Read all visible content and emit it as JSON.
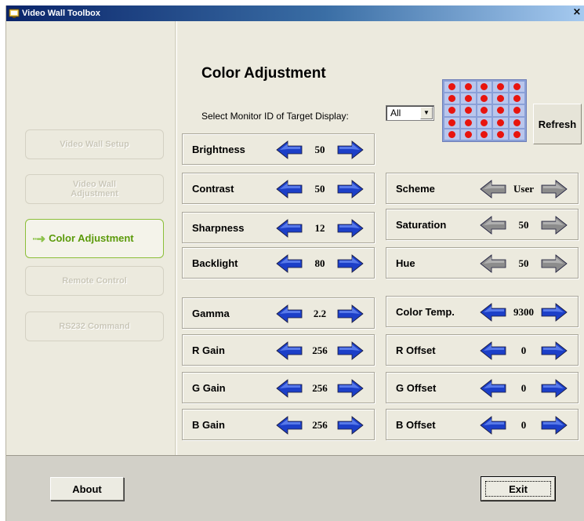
{
  "window": {
    "title": "Video Wall Toolbox",
    "close_glyph": "×"
  },
  "sidebar": {
    "items": [
      {
        "label": "Video Wall Setup",
        "state": "disabled"
      },
      {
        "label": "Video Wall Adjustment",
        "state": "disabled"
      },
      {
        "label": "Color Adjustment",
        "state": "active"
      },
      {
        "label": "Remote Control",
        "state": "disabled"
      },
      {
        "label": "RS232 Command",
        "state": "disabled"
      }
    ]
  },
  "main": {
    "heading": "Color Adjustment",
    "monitor_label": "Select Monitor ID of Target Display:",
    "monitor_value": "All",
    "refresh_label": "Refresh",
    "controls": [
      {
        "id": "brightness",
        "label": "Brightness",
        "value": "50",
        "enabled": true
      },
      {
        "id": "contrast",
        "label": "Contrast",
        "value": "50",
        "enabled": true
      },
      {
        "id": "scheme",
        "label": "Scheme",
        "value": "User",
        "enabled": false
      },
      {
        "id": "sharpness",
        "label": "Sharpness",
        "value": "12",
        "enabled": true
      },
      {
        "id": "saturation",
        "label": "Saturation",
        "value": "50",
        "enabled": false
      },
      {
        "id": "backlight",
        "label": "Backlight",
        "value": "80",
        "enabled": true
      },
      {
        "id": "hue",
        "label": "Hue",
        "value": "50",
        "enabled": false
      },
      {
        "id": "gamma",
        "label": "Gamma",
        "value": "2.2",
        "enabled": true
      },
      {
        "id": "color-temp",
        "label": "Color Temp.",
        "value": "9300",
        "enabled": true
      },
      {
        "id": "r-gain",
        "label": "R Gain",
        "value": "256",
        "enabled": true
      },
      {
        "id": "r-offset",
        "label": "R Offset",
        "value": "0",
        "enabled": true
      },
      {
        "id": "g-gain",
        "label": "G Gain",
        "value": "256",
        "enabled": true
      },
      {
        "id": "g-offset",
        "label": "G Offset",
        "value": "0",
        "enabled": true
      },
      {
        "id": "b-gain",
        "label": "B Gain",
        "value": "256",
        "enabled": true
      },
      {
        "id": "b-offset",
        "label": "B Offset",
        "value": "0",
        "enabled": true
      }
    ]
  },
  "footer": {
    "about_label": "About",
    "exit_label": "Exit"
  },
  "colors": {
    "accent_active": "#5b9a0a",
    "arrow_enabled": "#1c3fc8",
    "arrow_disabled": "#8c8c8c",
    "monitor_dot": "#e8140e"
  }
}
